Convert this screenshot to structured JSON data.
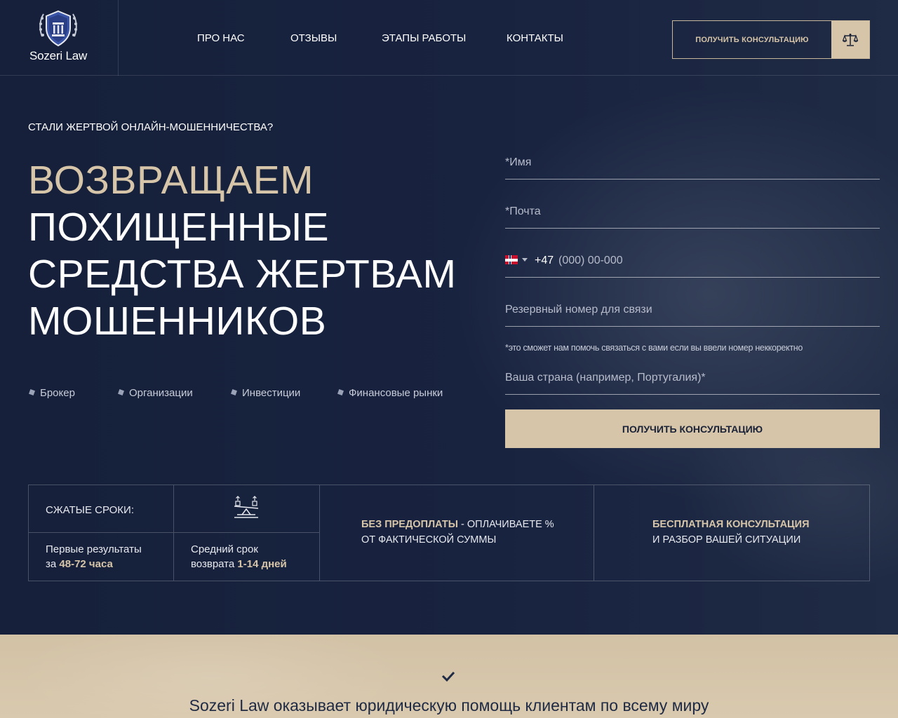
{
  "header": {
    "logo_text": "Sozeri Law",
    "nav": [
      "ПРО НАС",
      "ОТЗЫВЫ",
      "ЭТАПЫ РАБОТЫ",
      "КОНТАКТЫ"
    ],
    "cta_label": "ПОЛУЧИТЬ КОНСУЛЬТАЦИЮ",
    "cta_icon": "scales-icon"
  },
  "hero": {
    "eyebrow": "СТАЛИ ЖЕРТВОЙ ОНЛАЙН-МОШЕННИЧЕСТВА?",
    "headline_accent": "ВОЗВРАЩАЕМ",
    "headline_rest_1": "ПОХИЩЕННЫЕ",
    "headline_rest_2": "СРЕДСТВА ЖЕРТВАМ",
    "headline_rest_3": "МОШЕННИКОВ",
    "tags": [
      "Брокер",
      "Организации",
      "Инвестиции",
      "Финансовые рынки"
    ]
  },
  "form": {
    "name_placeholder": "*Имя",
    "email_placeholder": "*Почта",
    "phone_prefix": "+47",
    "phone_placeholder": "(000) 00-000",
    "reserve_placeholder": "Резервный номер для связи",
    "note": "*это сможет нам помочь связаться с вами если вы ввели номер неккоректно",
    "country_placeholder": "Ваша страна (например, Португалия)*",
    "submit_label": "ПОЛУЧИТЬ КОНСУЛЬТАЦИЮ"
  },
  "features": {
    "deadline_label": "СЖАТЫЕ СРОКИ:",
    "first_results_1": "Первые результаты",
    "first_results_2_prefix": "за ",
    "first_results_2_value": "48-72 часа",
    "avg_return_1": "Средний срок",
    "avg_return_2_prefix": "возврата ",
    "avg_return_2_value": "1-14 дней",
    "no_prepay_bold": "БЕЗ ПРЕДОПЛАТЫ",
    "no_prepay_rest": " - ОПЛАЧИВАЕТЕ %",
    "no_prepay_line2": "ОТ ФАКТИЧЕСКОЙ СУММЫ",
    "free_consult_bold": "БЕСПЛАТНАЯ КОНСУЛЬТАЦИЯ",
    "free_consult_line2": "И РАЗБОР ВАШЕЙ СИТУАЦИИ"
  },
  "band": {
    "text": "Sozeri Law оказывает юридическую помощь клиентам по всему миру"
  },
  "colors": {
    "navy": "#16203a",
    "gold": "#d6c5a8",
    "band": "#d9c9ae"
  }
}
